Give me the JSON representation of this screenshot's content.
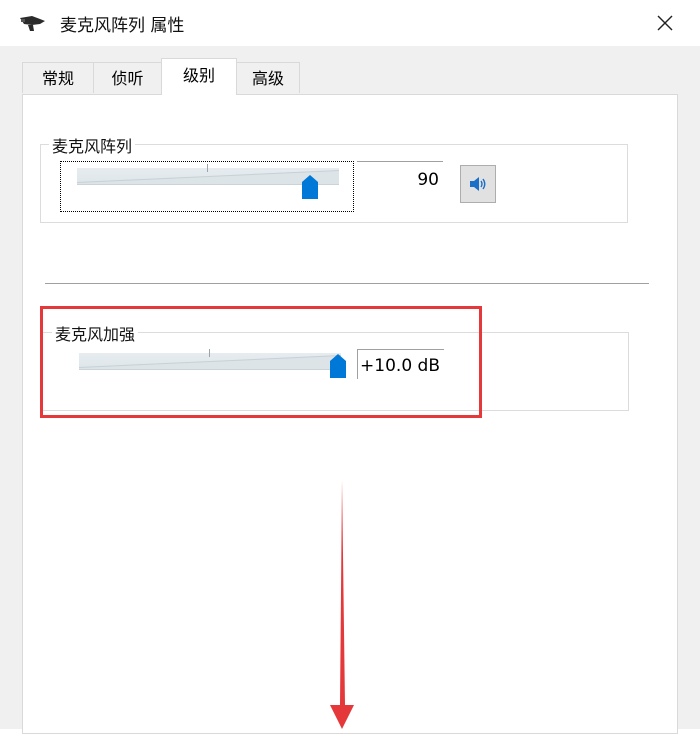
{
  "window": {
    "title": "麦克风阵列 属性",
    "close_icon": "close-icon",
    "app_icon": "microphone-icon"
  },
  "tabs": [
    {
      "label": "常规",
      "active": false
    },
    {
      "label": "侦听",
      "active": false
    },
    {
      "label": "级别",
      "active": true
    },
    {
      "label": "高级",
      "active": false
    }
  ],
  "levels": {
    "mic_array": {
      "label": "麦克风阵列",
      "value": "90",
      "level_percent": 90,
      "mute_icon": "speaker-icon"
    },
    "mic_boost": {
      "label": "麦克风加强",
      "value": "+10.0 dB",
      "level_fraction": 1.0
    }
  },
  "annotations": {
    "highlight_color": "#e5383b",
    "arrow_direction": "down"
  }
}
